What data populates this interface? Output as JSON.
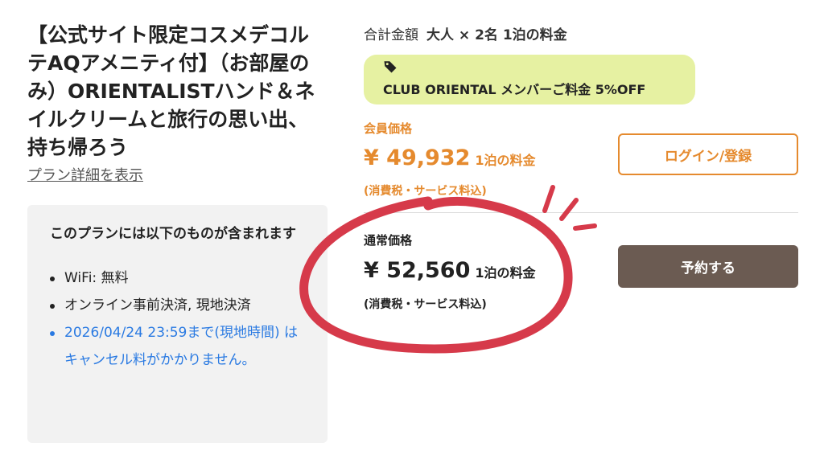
{
  "plan": {
    "title": "【公式サイト限定コスメデコルテAQアメニティ付】（お部屋のみ）ORIENTALISTハンド＆ネイルクリームと旅行の思い出、持ち帰ろう",
    "details_link": "プラン詳細を表示"
  },
  "includes": {
    "heading": "このプランには以下のものが含まれます",
    "items": [
      "WiFi: 無料",
      "オンライン事前決済, 現地決済",
      "2026/04/24 23:59まで(現地時間) はキャンセル料がかかりません。"
    ]
  },
  "summary": {
    "total_label": "合計金額",
    "guests": "大人 × 2名 1泊の料金"
  },
  "member_offer": {
    "icon": "tag-icon",
    "text": "CLUB ORIENTAL メンバーご料金 5%OFF"
  },
  "member_price": {
    "label": "会員価格",
    "amount": "¥ 49,932",
    "per": "1泊の料金",
    "tax_note": "(消費税・サービス料込)"
  },
  "regular_price": {
    "label": "通常価格",
    "amount": "¥ 52,560",
    "per": "1泊の料金",
    "tax_note": "(消費税・サービス料込)"
  },
  "buttons": {
    "login": "ログイン/登録",
    "reserve": "予約する"
  },
  "colors": {
    "accent_orange": "#e58a2e",
    "reserve_brown": "#6b5b52",
    "member_pill": "#e6f1a2",
    "policy_link_blue": "#2a7ae2",
    "annotation_red": "#d63a4a"
  }
}
